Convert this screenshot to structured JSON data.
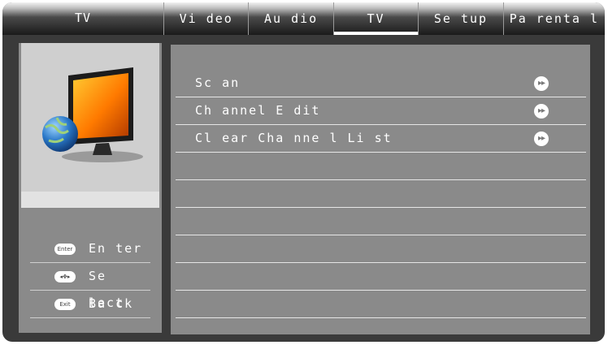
{
  "topbar": {
    "title": "TV",
    "tabs": [
      {
        "label": "Vi deo"
      },
      {
        "label": "Au dio"
      },
      {
        "label": "TV",
        "active": true
      },
      {
        "label": "Se tup"
      },
      {
        "label": "Pa renta l"
      }
    ]
  },
  "sidebar": {
    "preview_icon": "tv-globe-icon",
    "hints": [
      {
        "key_label": "Enter",
        "label": "En ter",
        "icon": "enter-key-icon"
      },
      {
        "key_label": "◂✥▸",
        "label": "Se lect",
        "icon": "dpad-icon"
      },
      {
        "key_label": "Exit",
        "label": "Ba ck",
        "icon": "exit-key-icon"
      }
    ]
  },
  "menu": {
    "items": [
      {
        "label": "Sc an",
        "icon": "forward-arrow-icon"
      },
      {
        "label": "Ch annel E dit",
        "icon": "forward-arrow-icon"
      },
      {
        "label": "Cl ear Cha nne l Li st",
        "icon": "forward-arrow-icon"
      }
    ],
    "empty_rows": 6
  },
  "colors": {
    "background": "#3a3a3a",
    "panel": "#8a8a8a",
    "preview": "#cfcfcf",
    "text": "#ffffff"
  }
}
